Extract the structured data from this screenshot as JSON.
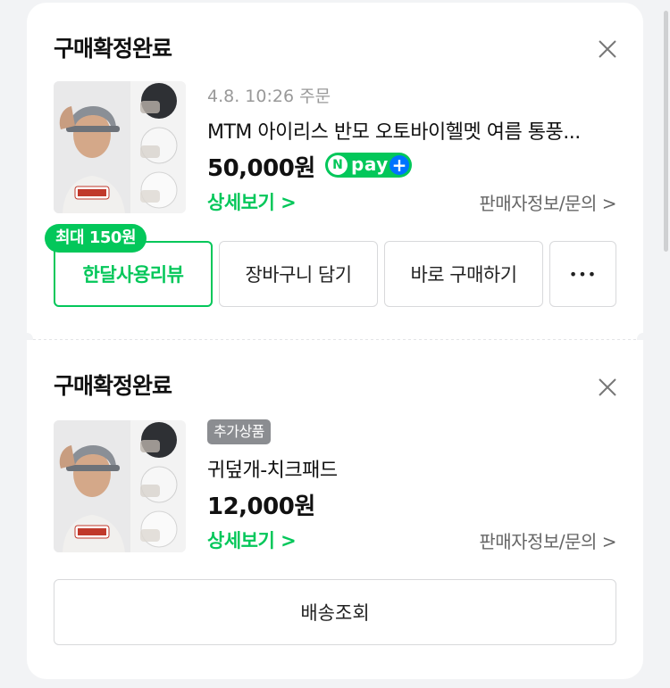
{
  "orders": [
    {
      "status": "구매확정완료",
      "order_time": "4.8. 10:26 주문",
      "product_name": "MTM 아이리스 반모 오토바이헬멧 여름 통풍...",
      "price": "50,000원",
      "npay": {
        "n": "N",
        "label": "pay",
        "plus": "+"
      },
      "detail_link": "상세보기 >",
      "seller_link": "판매자정보/문의 >",
      "review_badge": "최대 150원",
      "buttons": {
        "review": "한달사용리뷰",
        "cart": "장바구니 담기",
        "buy": "바로 구매하기",
        "more": "•••"
      }
    },
    {
      "status": "구매확정완료",
      "tag": "추가상품",
      "product_name": "귀덮개-치크패드",
      "price": "12,000원",
      "detail_link": "상세보기 >",
      "seller_link": "판매자정보/문의 >",
      "track_button": "배송조회"
    }
  ],
  "colors": {
    "accent": "#03c75a",
    "npay_plus": "#0073ff",
    "tag_bg": "#8b8d91"
  },
  "icons": {
    "close": "close-icon",
    "thumbnail_shirt_logo": "Jack Hero"
  }
}
